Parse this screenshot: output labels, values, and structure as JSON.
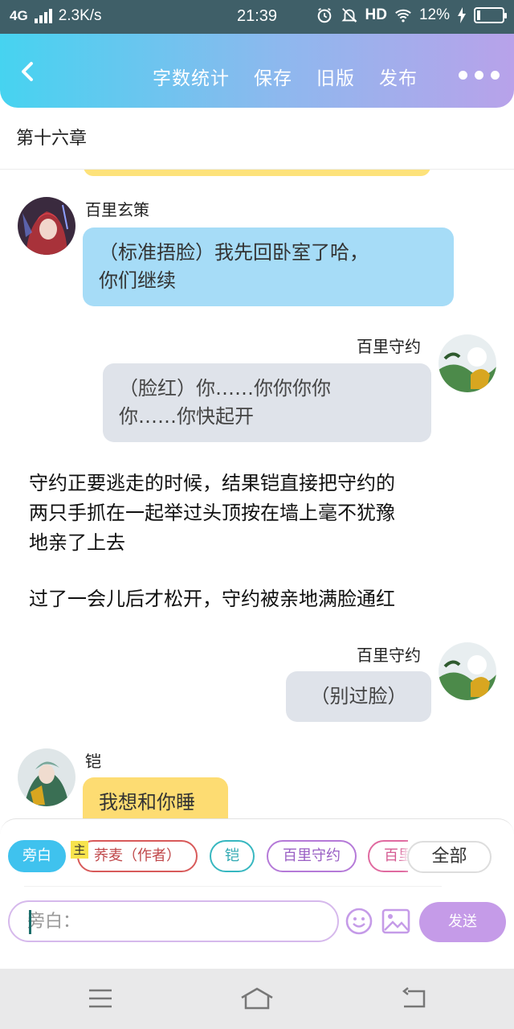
{
  "status_bar": {
    "network": "4G",
    "speed": "2.3K/s",
    "time": "21:39",
    "hd": "HD",
    "battery": "12%"
  },
  "header": {
    "actions": [
      "字数统计",
      "保存",
      "旧版",
      "发布"
    ]
  },
  "chapter_title": "第十六章",
  "messages": [
    {
      "speaker": "百里玄策",
      "text_lines": [
        "（标准捂脸）我先回卧室了哈，",
        "你们继续"
      ]
    },
    {
      "speaker": "百里守约",
      "text_lines": [
        "（脸红）你……你你你你",
        "你……你快起开"
      ]
    },
    {
      "narration": [
        "守约正要逃走的时候，结果铠直接把守约的",
        "两只手抓在一起举过头顶按在墙上毫不犹豫",
        "地亲了上去"
      ]
    },
    {
      "narration": [
        "过了一会儿后才松开，守约被亲地满脸通红"
      ]
    },
    {
      "speaker": "百里守约",
      "text_lines": [
        "（别过脸）"
      ]
    },
    {
      "speaker": "铠",
      "text_lines": [
        "我想和你睡"
      ]
    }
  ],
  "roles": {
    "chips": [
      "旁白",
      "荞麦（作者）",
      "铠",
      "百里守约",
      "百里"
    ],
    "author_badge": "主",
    "all_label": "全部"
  },
  "composer": {
    "placeholder": "旁白：",
    "send_label": "发送"
  },
  "colors": {
    "header_gradient": [
      "#46d3f0",
      "#b8a2ea"
    ],
    "bubble_blue": "#a6dcf7",
    "bubble_gray": "#dfe3ea",
    "bubble_yellow": "#fddc72",
    "send_button": "#c59be8"
  }
}
